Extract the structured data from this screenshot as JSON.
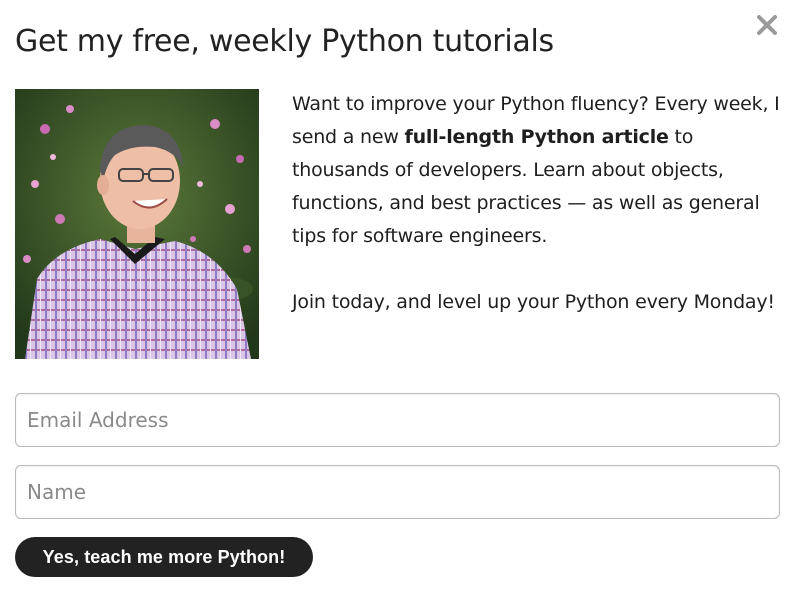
{
  "modal": {
    "title": "Get my free, weekly Python tutorials",
    "close_label": "×",
    "intro": {
      "p1_before": "Want to improve your Python fluency? Every week, I send a new ",
      "p1_bold": "full-length Python article",
      "p1_after": " to thousands of developers. Learn about objects, functions, and best practices — as well as general tips for software engineers.",
      "p2": "Join today, and level up your Python every Monday!"
    },
    "photo": {
      "icon": "author-photo"
    }
  },
  "form": {
    "email_placeholder": "Email Address",
    "email_value": "",
    "name_placeholder": "Name",
    "name_value": "",
    "submit_label": "Yes, teach me more Python!"
  },
  "colors": {
    "button_bg": "#222222",
    "button_text": "#ffffff",
    "title_text": "#222222",
    "body_text": "#1e1e1e",
    "input_border": "#b9b9b9",
    "close_icon": "#9a9a9a"
  }
}
